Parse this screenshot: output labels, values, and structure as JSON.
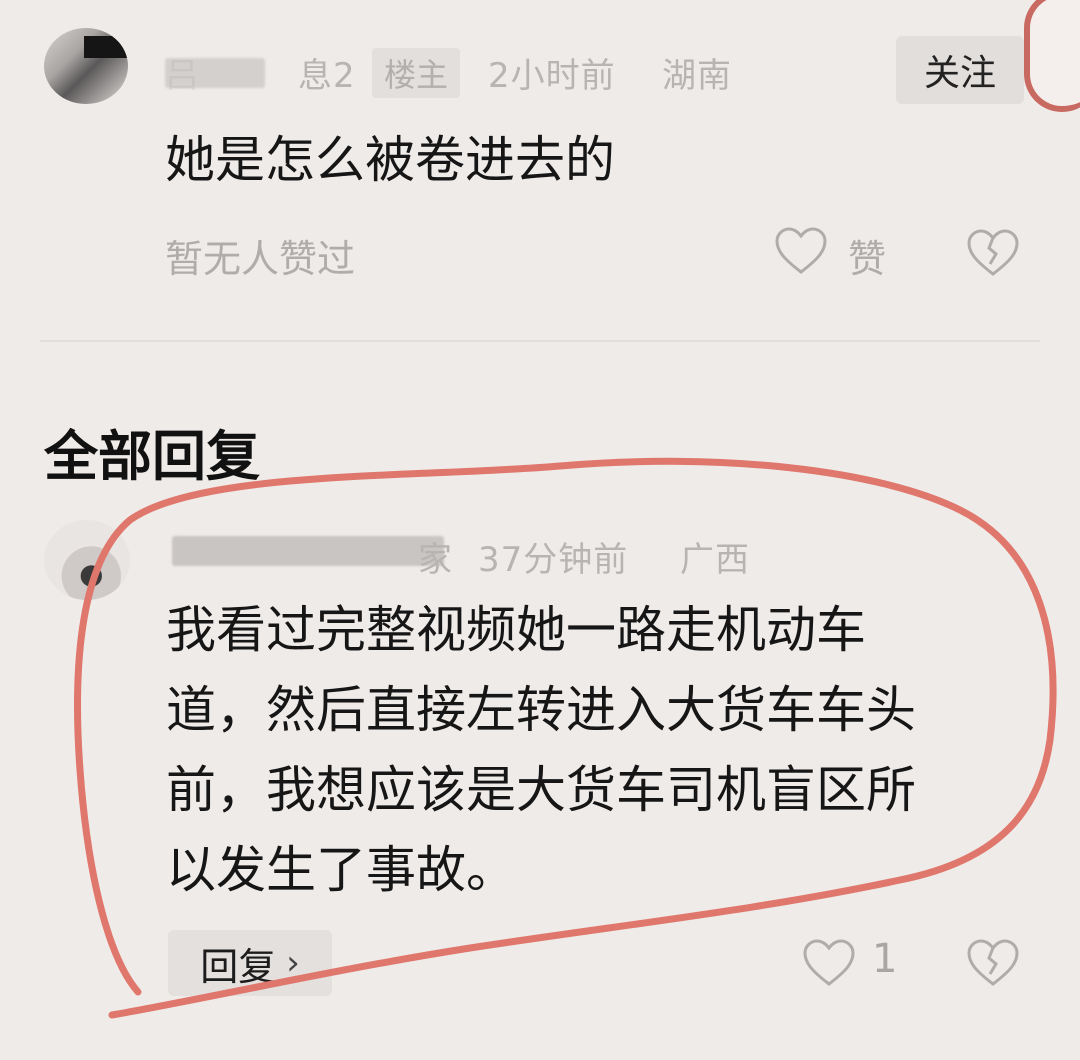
{
  "thread": {
    "op_comment": {
      "meta_visible_fragment_1": "吕",
      "meta_visible_fragment_2": "息2",
      "badge": "楼主",
      "time": "2小时前",
      "location": "湖南",
      "follow_label": "关注",
      "text": "她是怎么被卷进去的",
      "likes_status": "暂无人赞过",
      "like_label": "赞"
    },
    "section_title": "全部回复",
    "reply": {
      "meta_visible_fragment": "家",
      "time": "37分钟前",
      "location": "广西",
      "text_lines": [
        "我看过完整视频她一路走机动车",
        "道，然后直接左转进入大货车车头",
        "前，我想应该是大货车司机盲区所",
        "以发生了事故。"
      ],
      "reply_button_label": "回复",
      "like_count": "1"
    }
  },
  "icons": {
    "like": "heart-outline-icon",
    "dislike": "broken-heart-icon",
    "chevron": "chevron-right-icon"
  },
  "colors": {
    "background": "#efebe9",
    "annotation": "#e0776c",
    "muted_text": "#b0acaa"
  }
}
